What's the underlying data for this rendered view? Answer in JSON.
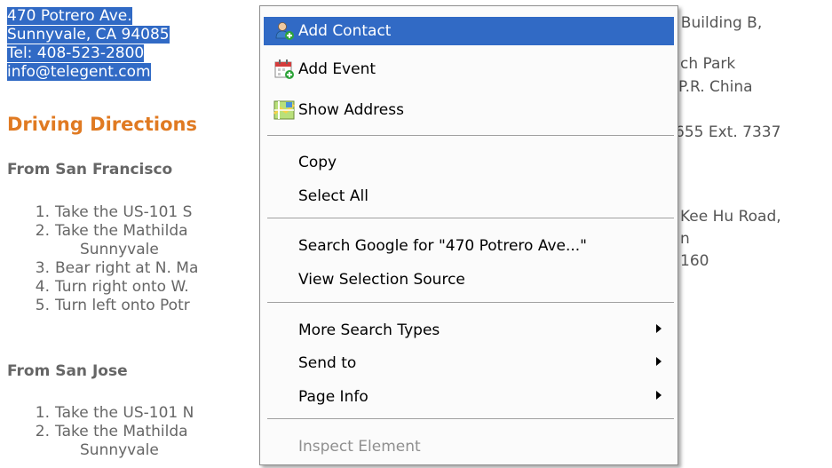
{
  "address": {
    "street": "470 Potrero Ave.",
    "city": "Sunnyvale, CA 94085",
    "tel": "Tel: 408-523-2800",
    "email": "info@telegent.com"
  },
  "directions": {
    "title": "Driving Directions",
    "from_sf": {
      "heading": "From San Francisco",
      "steps": [
        "Take the US-101 S",
        "Take the Mathilda",
        "Sunnyvale",
        "Bear right at N. Ma",
        "Turn right onto W.",
        "Turn left onto Potr"
      ],
      "numbers": [
        "1.",
        "2.",
        "3.",
        "4.",
        "5."
      ]
    },
    "from_sj": {
      "heading": "From San Jose",
      "steps": [
        "Take the US-101 N",
        "Take the Mathilda",
        "Sunnyvale"
      ],
      "numbers": [
        "1.",
        "2."
      ]
    }
  },
  "right_fragments": {
    "building": ", Building B,",
    "park": "ch Park",
    "china": "P.R. China",
    "ext": "655  Ext. 7337",
    "road": "Kee Hu Road,",
    "n": "n",
    "num160": "160"
  },
  "context_menu": {
    "items": [
      {
        "label": "Add Contact",
        "icon": "add-contact-icon"
      },
      {
        "label": "Add Event",
        "icon": "calendar-add-icon"
      },
      {
        "label": "Show Address",
        "icon": "map-icon"
      },
      {
        "label": "Copy"
      },
      {
        "label": "Select All"
      },
      {
        "label": "Search Google for \"470 Potrero Ave...\""
      },
      {
        "label": "View Selection Source"
      },
      {
        "label": "More Search Types"
      },
      {
        "label": "Send to"
      },
      {
        "label": "Page Info"
      },
      {
        "label": "Inspect Element"
      }
    ]
  },
  "colors": {
    "selection": "#316ac5",
    "heading_orange": "#e07a22",
    "disabled_text": "#8f8f8f"
  }
}
